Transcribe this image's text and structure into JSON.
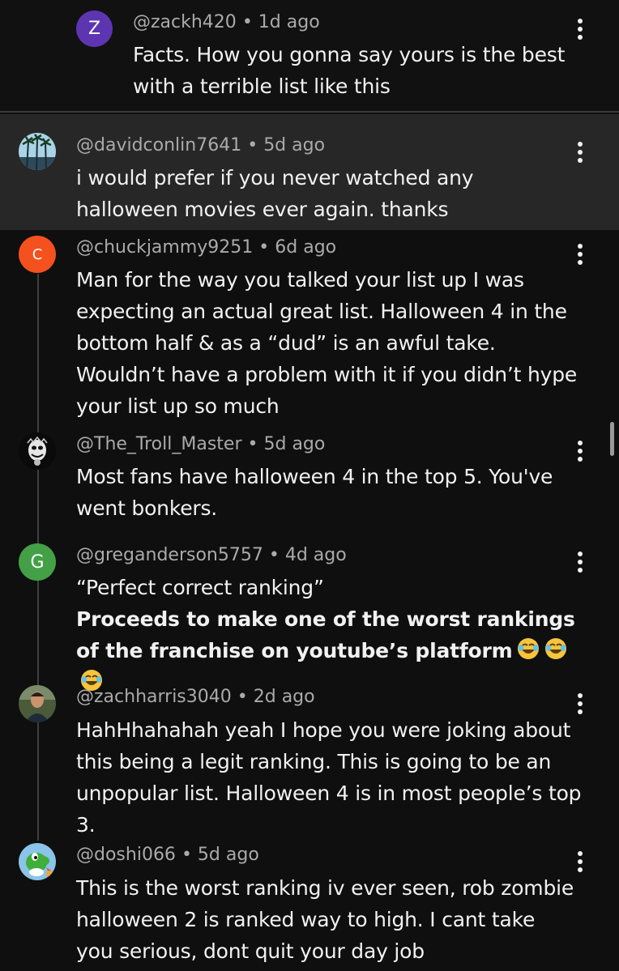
{
  "comments": [
    {
      "user": "@zackh420",
      "age": "1d ago",
      "avatar_letter": "Z",
      "avatar_color": "#5e35b1",
      "text": "Facts. How you gonna say yours is the best with a terrible list like this"
    },
    {
      "user": "@davidconlin7641",
      "age": "5d ago",
      "avatar_desc": "palm-trees-photo",
      "text": "i would prefer if you never watched any halloween movies ever again. thanks"
    },
    {
      "user": "@chuckjammy9251",
      "age": "6d ago",
      "avatar_letter": "C",
      "avatar_color": "#f4511e",
      "text": "Man for the way you talked your list up I was expecting an actual great list. Halloween 4 in the bottom half & as a “dud” is an awful take. Wouldn’t have a problem with it if you didn’t hype your list up so much"
    },
    {
      "user": "@The_Troll_Master",
      "age": "5d ago",
      "avatar_desc": "troll-mask-photo",
      "text": "Most fans have halloween 4 in the top 5. You've went bonkers."
    },
    {
      "user": "@greganderson5757",
      "age": "4d ago",
      "avatar_letter": "G",
      "avatar_color": "#43a047",
      "text": "“Perfect correct ranking”",
      "bold_text": "Proceeds to make one of the worst rankings of the franchise on youtube’s platform",
      "emoji": "😂😂😂"
    },
    {
      "user": "@zachharris3040",
      "age": "2d ago",
      "avatar_desc": "person-photo",
      "text": "HahHhahahah yeah I hope you were joking about this being a legit ranking. This is going to be an unpopular list. Halloween 4 is in most people’s top 3."
    },
    {
      "user": "@doshi066",
      "age": "5d ago",
      "avatar_desc": "yoshi-photo",
      "text": "This is the worst ranking iv ever seen, rob zombie halloween 2 is ranked way to high. I cant take you serious, dont quit your day job"
    }
  ],
  "separator": "•",
  "icons": {
    "menu": "more-vert-icon",
    "emoji": "face-with-tears-of-joy-icon"
  },
  "colors": {
    "background": "#0f0f0f",
    "highlight": "#272727",
    "meta_text": "#aaaaaa",
    "body_text": "#f1f1f1"
  }
}
